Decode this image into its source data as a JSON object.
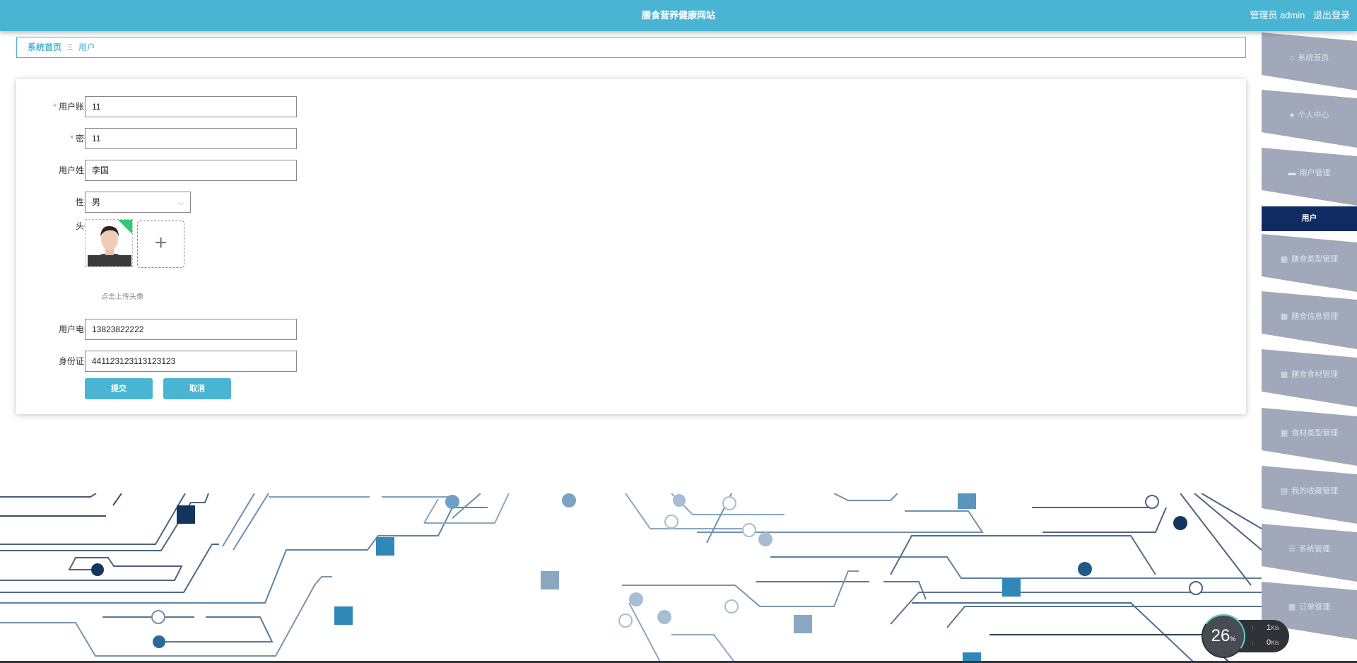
{
  "header": {
    "title": "膳食营养健康网站",
    "user": "管理员 admin",
    "logout": "退出登录"
  },
  "breadcrumb": {
    "home": "系统首页",
    "separator": "Ξ",
    "current": "用户"
  },
  "form": {
    "account": {
      "label": "用户账号",
      "value": "11",
      "required": true
    },
    "password": {
      "label": "密码",
      "value": "11",
      "required": true
    },
    "name": {
      "label": "用户姓名",
      "value": "李国"
    },
    "gender": {
      "label": "性别",
      "value": "男"
    },
    "avatar": {
      "label": "头像",
      "hint": "点击上传头像"
    },
    "phone": {
      "label": "用户电话",
      "value": "13823822222"
    },
    "idcard": {
      "label": "身份证号",
      "value": "441123123113123123"
    },
    "submit": "提交",
    "cancel": "取消"
  },
  "sidebar": {
    "items": [
      {
        "label": "系统首页",
        "icon": "home-icon"
      },
      {
        "label": "个人中心",
        "icon": "user-icon"
      },
      {
        "label": "用户管理",
        "icon": "briefcase-icon"
      },
      {
        "label": "膳食类型管理",
        "icon": "grid-icon"
      },
      {
        "label": "膳食信息管理",
        "icon": "grid-icon"
      },
      {
        "label": "膳食食材管理",
        "icon": "grid-icon"
      },
      {
        "label": "食材类型管理",
        "icon": "grid-icon"
      },
      {
        "label": "我的收藏管理",
        "icon": "clipboard-icon"
      },
      {
        "label": "系统管理",
        "icon": "list-icon"
      },
      {
        "label": "订单管理",
        "icon": "table-icon"
      }
    ],
    "active_sub": "用户"
  },
  "widget": {
    "percent": "26",
    "percent_unit": "%",
    "up": "1",
    "down": "0",
    "unit": "K/s"
  },
  "colors": {
    "accent": "#4ab5d3",
    "sidebar": "#a0a8b9",
    "active": "#102a62"
  }
}
